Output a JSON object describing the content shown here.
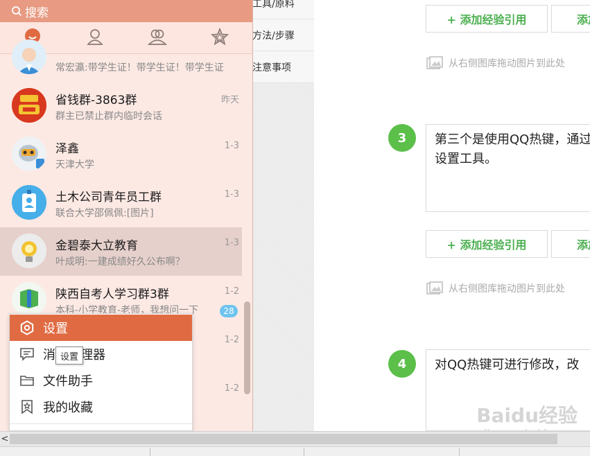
{
  "qq": {
    "search_placeholder": "搜索",
    "tabs": [
      {
        "icon": "chat-bubble-icon"
      },
      {
        "icon": "contact-person-icon"
      },
      {
        "icon": "group-people-icon"
      },
      {
        "icon": "star-icon"
      }
    ],
    "contacts": [
      {
        "name": "",
        "message": "常宏瀛:带学生证！带学生证！带学生证",
        "time": ""
      },
      {
        "name": "省钱群-3863群",
        "message": "群主已禁止群内临时会话",
        "time": "昨天"
      },
      {
        "name": "泽鑫",
        "message": "天津大学",
        "time": "1-3"
      },
      {
        "name": "土木公司青年员工群",
        "message": "联合大学邵佩佩:[图片]",
        "time": "1-3"
      },
      {
        "name": "金碧泰大立教育",
        "message": "叶成明:一建成绩好久公布啊？",
        "time": "1-3"
      },
      {
        "name": "陕西自考人学习群3群",
        "message": "本科-小学教育-老师，我想问一下",
        "time": "1-2",
        "badge": "28"
      },
      {
        "name": "",
        "message": "",
        "time": "1-2"
      },
      {
        "name": "",
        "message": "",
        "time": "1-2"
      }
    ],
    "menu": {
      "items": [
        {
          "label": "设置",
          "icon": "settings-hexagon-icon"
        },
        {
          "label": "消息管理器",
          "icon": "message-manager-icon"
        },
        {
          "label": "文件助手",
          "icon": "folder-icon"
        },
        {
          "label": "我的收藏",
          "icon": "favorites-icon"
        }
      ],
      "tooltip": "设置"
    },
    "colors": {
      "accent": "#e06b43",
      "panel_bg": "#fde9e4",
      "header": "#e89a82"
    }
  },
  "editor": {
    "nav_items": [
      "工具/原料",
      "方法/步骤",
      "注意事项"
    ],
    "cite_button": "+ 添加经验引用",
    "cite_button_2": "添加",
    "drop_hint": "从右侧图库拖动图片到此处",
    "steps": [
      {
        "number": "3",
        "text": "第三个是使用QQ热键，通过设置工具。"
      },
      {
        "number": "4",
        "text": "对QQ热键可进行修改，改"
      }
    ],
    "watermark": "Baidu经验",
    "watermark_url": "jingyan.baidu.com",
    "colors": {
      "step": "#5bbf4a",
      "cite_text": "#4caf50"
    }
  },
  "scrollbar": {
    "left_arrow": "<"
  }
}
